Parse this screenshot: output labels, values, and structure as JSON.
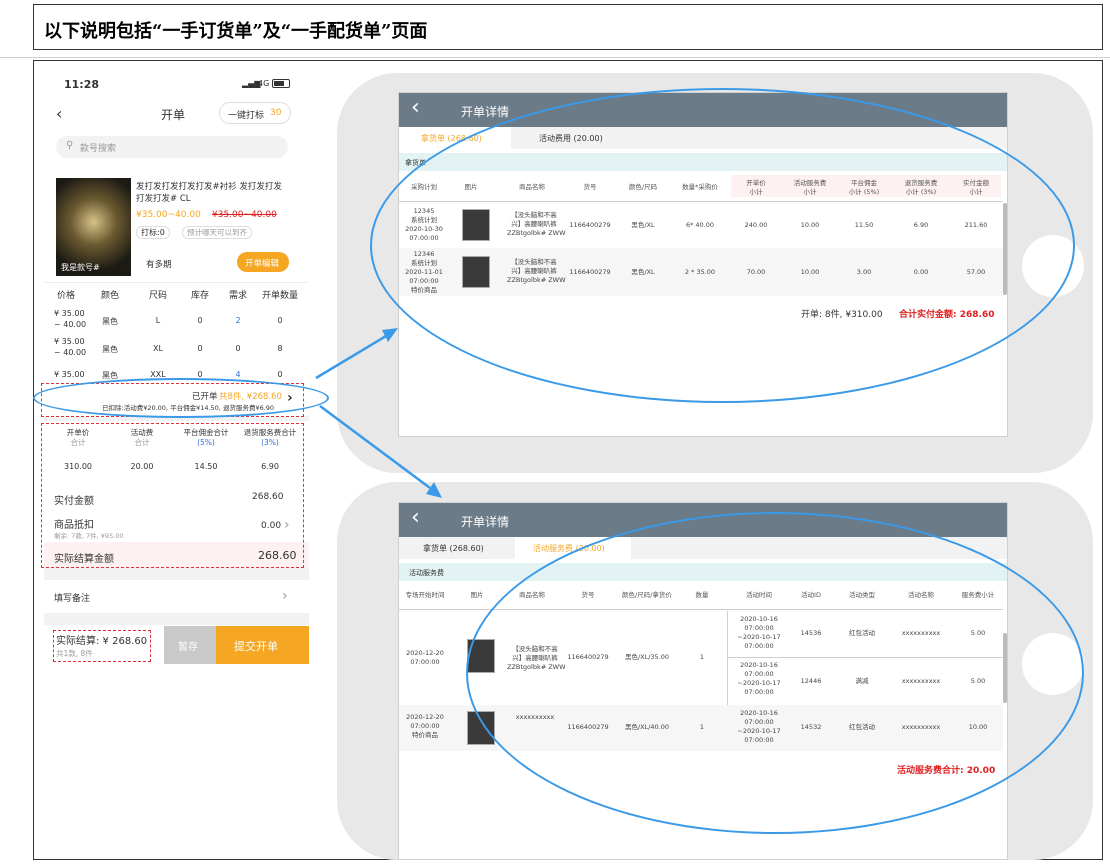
{
  "heading": "以下说明包括“一手订货单”及“一手配货单”页面",
  "phone": {
    "time": "11:28",
    "network": "4G",
    "title": "开单",
    "one_click_label": "一键打标",
    "one_click_count": "30",
    "search_placeholder": "款号搜索",
    "product": {
      "name": "发打发打发打发打发#衬衫 发打发打发打发打发# CL",
      "price": "¥35.00~40.00",
      "orig_price": "¥35.00~40.00",
      "tag": "打标:0",
      "tag2": "预计哪天可以到齐",
      "caption": "我是款号#",
      "multi": "有多期",
      "edit_btn": "开单编辑"
    },
    "table_headers": [
      "价格",
      "颜色",
      "尺码",
      "库存",
      "需求",
      "开单数量"
    ],
    "rows": [
      {
        "price": "¥ 35.00\n~ 40.00",
        "color": "黑色",
        "size": "L",
        "stock": "0",
        "demand": "2",
        "qty": "0"
      },
      {
        "price": "¥ 35.00\n~ 40.00",
        "color": "黑色",
        "size": "XL",
        "stock": "0",
        "demand": "0",
        "qty": "8"
      },
      {
        "price": "¥ 35.00",
        "color": "黑色",
        "size": "XXL",
        "stock": "0",
        "demand": "4",
        "qty": "0"
      }
    ],
    "summary_label": "已开单",
    "summary_value": "共8件, ¥268.60",
    "summary_sub": "已扣除:活动费¥20.00, 平台佣金¥14.50, 退货服务费¥6.90",
    "fee_headers": [
      [
        "开单价",
        "合计"
      ],
      [
        "活动费",
        "合计"
      ],
      [
        "平台佣金合计",
        "(5%)"
      ],
      [
        "退货服务费合计",
        "(3%)"
      ]
    ],
    "fee_values": [
      "310.00",
      "20.00",
      "14.50",
      "6.90"
    ],
    "actual_label": "实付金额",
    "actual_value": "268.60",
    "deduct_label": "商品抵扣",
    "deduct_sub": "剩余: 7款, 7件, ¥95.00",
    "deduct_value": "0.00",
    "settle_label": "实际结算金额",
    "settle_value": "268.60",
    "remark_label": "填写备注",
    "footer_label": "实际结算: ¥ 268.60",
    "footer_sub": "共1款, 8件",
    "save_btn": "暂存",
    "submit_btn": "提交开单"
  },
  "tablet1": {
    "title": "开单详情",
    "tab_active": "拿货单 (268.60)",
    "tab_other": "活动费用 (20.00)",
    "section": "拿货单",
    "headers": [
      "采购计划",
      "图片",
      "商品名称",
      "货号",
      "颜色/尺码",
      "数量*采购价",
      "开单价\n小计",
      "活动服务费\n小计",
      "平台佣金\n小计 (5%)",
      "退货服务费\n小计 (3%)",
      "实付金额\n小计"
    ],
    "rows": [
      {
        "plan": "12345\n系统计划\n2020-10-30\n07:00:00",
        "special": "",
        "name": "【没头脑和不高\n兴】高腰喇叭裤\nZZBtgolbk# ZWW",
        "sku": "1166400279",
        "spec": "黑色/XL",
        "qty": "6* 40.00",
        "open": "240.00",
        "act": "10.00",
        "plat": "11.50",
        "ret": "6.90",
        "paid": "211.60"
      },
      {
        "plan": "12346\n系统计划\n2020-11-01\n07:00:00",
        "special": "特价商品",
        "name": "【没头脑和不高\n兴】高腰喇叭裤\nZZBtgolbk# ZWW",
        "sku": "1166400279",
        "spec": "黑色/XL",
        "qty": "2 * 35.00",
        "open": "70.00",
        "act": "10.00",
        "plat": "3.00",
        "ret": "0.00",
        "paid": "57.00"
      }
    ],
    "total_count": "开单: 8件, ¥310.00",
    "total_paid": "合计实付金额: 268.60"
  },
  "tablet2": {
    "title": "开单详情",
    "tab_other": "拿货单 (268.60)",
    "tab_active": "活动服务费 (20.00)",
    "section": "活动服务费",
    "headers": [
      "专场开始时间",
      "图片",
      "商品名称",
      "货号",
      "颜色/尺码/拿货价",
      "数量",
      "活动时间",
      "活动ID",
      "活动类型",
      "活动名称",
      "服务费小计"
    ],
    "g1_time": "2020-12-20\n07:00:00",
    "g1_name": "【没头脑和不高\n兴】高腰喇叭裤\nZZBtgolbk# ZWW",
    "g1_sku": "1166400279",
    "g1_spec": "黑色/XL/35.00",
    "g1_qty": "1",
    "g1_sub": [
      {
        "time": "2020-10-16\n07:00:00\n~2020-10-17\n07:00:00",
        "id": "14536",
        "type": "红包活动",
        "name": "xxxxxxxxxx",
        "fee": "5.00"
      },
      {
        "time": "2020-10-16\n07:00:00\n~2020-10-17\n07:00:00",
        "id": "12446",
        "type": "满减",
        "name": "xxxxxxxxxx",
        "fee": "5.00"
      }
    ],
    "g2": {
      "time": "2020-12-20\n07:00:00",
      "special": "特价商品",
      "name": "xxxxxxxxxx",
      "sku": "1166400279",
      "spec": "黑色/XL/40.00",
      "qty": "1",
      "atime": "2020-10-16\n07:00:00\n~2020-10-17\n07:00:00",
      "id": "14532",
      "type": "红包活动",
      "fee": "10.00"
    },
    "total": "活动服务费合计: 20.00"
  },
  "colors": {
    "accent": "#f5a623",
    "header": "#6c7b88",
    "ellipse": "#3a9ae8",
    "dash": "#e0303a"
  }
}
